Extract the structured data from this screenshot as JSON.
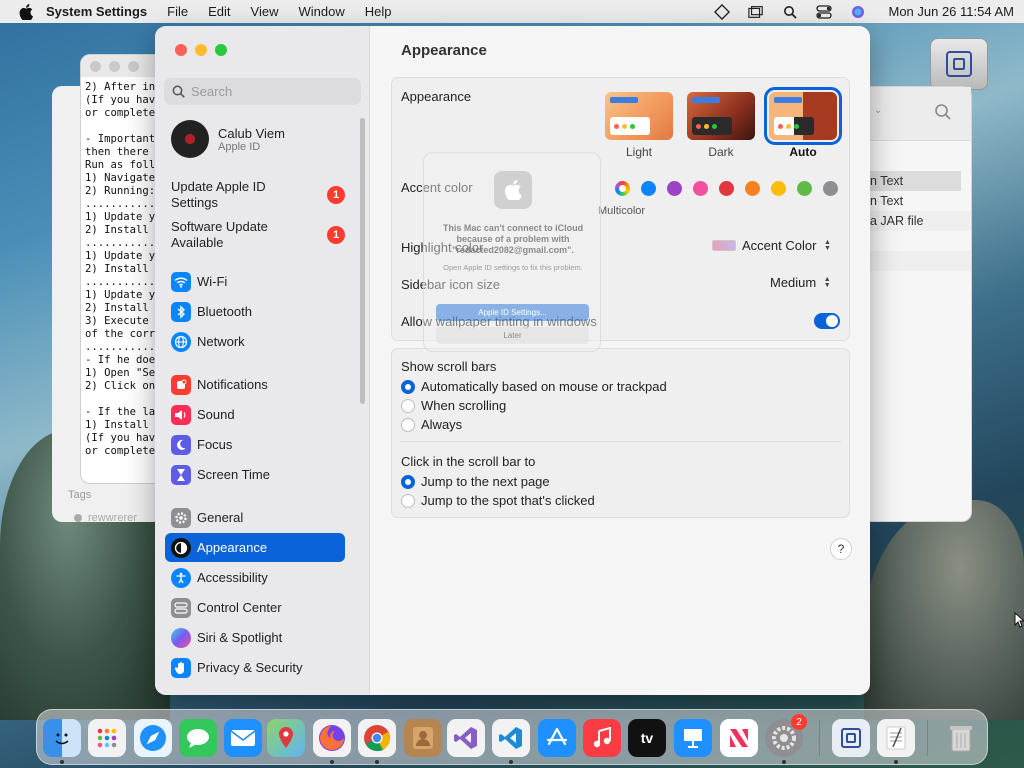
{
  "menubar": {
    "app_name": "System Settings",
    "menus": [
      "File",
      "Edit",
      "View",
      "Window",
      "Help"
    ],
    "clock": "Mon Jun 26  11:54 AM"
  },
  "terminal": {
    "text": "2) After in\n(If you hav\nor complete\n\n- Important\nthen there \nRun as foll\n1) Navigate\n2) Running:\n...........\n1) Update y\n2) Install \n...........\n1) Update y\n2) Install \n...........\n1) Update y\n2) Install \n3) Execute \nof the corr\n...........\n- If he doe\n1) Open \"Se\n2) Click on\n\n- If the la\n1) Install \n(If you hav\nor complete"
  },
  "finder_back": {
    "tags_label": "Tags",
    "tag_item": "rewwrerer",
    "rows": [
      "n Text",
      "n Text",
      "a JAR file"
    ]
  },
  "sidebar": {
    "search_placeholder": "Search",
    "profile_name": "Calub Viem",
    "profile_sub": "Apple ID",
    "alerts": [
      {
        "label": "Update Apple ID Settings",
        "badge": "1"
      },
      {
        "label": "Software Update Available",
        "badge": "1"
      }
    ],
    "items": [
      {
        "label": "Wi-Fi"
      },
      {
        "label": "Bluetooth"
      },
      {
        "label": "Network"
      },
      {
        "label": "Notifications"
      },
      {
        "label": "Sound"
      },
      {
        "label": "Focus"
      },
      {
        "label": "Screen Time"
      },
      {
        "label": "General"
      },
      {
        "label": "Appearance"
      },
      {
        "label": "Accessibility"
      },
      {
        "label": "Control Center"
      },
      {
        "label": "Siri & Spotlight"
      },
      {
        "label": "Privacy & Security"
      }
    ]
  },
  "content": {
    "title": "Appearance",
    "appearance_label": "Appearance",
    "themes": [
      {
        "label": "Light"
      },
      {
        "label": "Dark"
      },
      {
        "label": "Auto"
      }
    ],
    "accent_label": "Accent color",
    "accent_multicolor": "Multicolor",
    "accent_colors": [
      "#0a84ff",
      "#9b43c4",
      "#f0509e",
      "#e0383e",
      "#f6821f",
      "#fcbc0c",
      "#62ba46",
      "#8e8e93"
    ],
    "highlight_label": "Highlight color",
    "highlight_value": "Accent Color",
    "sidebar_icon_label": "Sidebar icon size",
    "sidebar_icon_value": "Medium",
    "wallpaper_tint_label": "Allow wallpaper tinting in windows",
    "scroll_title": "Show scroll bars",
    "scroll_options": [
      "Automatically based on mouse or trackpad",
      "When scrolling",
      "Always"
    ],
    "click_title": "Click in the scroll bar to",
    "click_options": [
      "Jump to the next page",
      "Jump to the spot that's clicked"
    ],
    "help": "?"
  },
  "dialog": {
    "message": "This Mac can't connect to iCloud because of a problem with \"redacted2082@gmail.com\".",
    "sub": "Open Apple ID settings to fix this problem.",
    "primary": "Apple ID Settings...",
    "secondary": "Later"
  },
  "dock": {
    "settings_badge": "2",
    "tv_label": "tv"
  }
}
